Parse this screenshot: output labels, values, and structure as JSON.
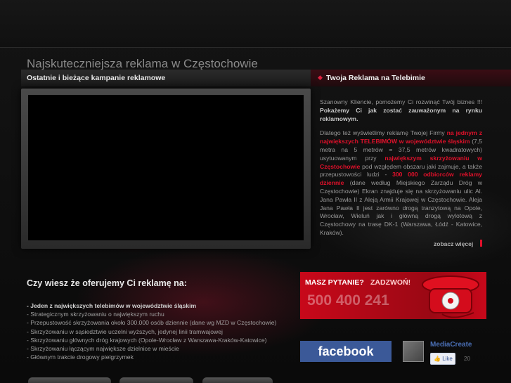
{
  "header": {
    "headline": "Najskuteczniejsza reklama w Częstochowie"
  },
  "left_panel": {
    "title": "Ostatnie i bieżące kampanie reklamowe"
  },
  "right_panel": {
    "title": "Twoja Reklama na Telebimie",
    "paragraph1_a": "Szanowny Kliencie, pomożemy Ci rozwinąć Twój biznes !!! ",
    "paragraph1_b": "Pokażemy Ci jak zostać zauważonym na rynku reklamowym.",
    "p2_1": "Dlatego też wyświetlimy reklamę Twojej Firmy ",
    "p2_2": "na jednym z największych TELEBIMÓW w województwie śląskim",
    "p2_3": " (7,5 metra na 5 metrów = 37,5 metrów kwadratowych) usytuowanym przy ",
    "p2_4": "największym skrzyżowaniu w Częstochowie",
    "p2_5": " pod względem obszaru jaki zajmuje, a także przepustowości ludzi - ",
    "p2_6": "300 000 odbiorców reklamy dziennie",
    "p2_7": " (dane według Miejskiego Zarządu Dróg w Częstochowie) Ekran znajduje się na skrzyżowaniu ulic Al. Jana Pawła II z Aleją Armii Krajowej w Częstochowie. Aleja Jana Pawła II jest zarówno drogą tranzytową na Opole, Wrocław, Wieluń jak i główną drogą wylotową z Częstochowy na trasę DK-1 (Warszawa, Łódź - Katowice, Kraków).",
    "more_link": "zobacz więcej"
  },
  "offer": {
    "question": "Czy wiesz że oferujemy Ci reklamę na:",
    "items": [
      "- Jeden z największych telebimów w województwie śląskim",
      "- Strategicznym skrzyżowaniu o największym ruchu",
      "- Przepustowość skrzyżowania około 300.000 osób dziennie (dane wg MZD w Częstochowie)",
      "- Skrzyżowaniu w sąsiedztwie uczelni wyższych, jedynej linii tramwajowej",
      "- Skrzyżowaniu głównych dróg krajowych (Opole-Wrocław z Warszawa-Kraków-Katowice)",
      "- Skrzyżowaniu łączącym największe dzielnice w mieście",
      "- Głównym trakcie drogowy pielgrzymek"
    ]
  },
  "phone_box": {
    "question": "MASZ PYTANIE?",
    "call": "ZADZWOŃ!",
    "number": "500 400 241"
  },
  "facebook": {
    "logo": "facebook",
    "page_name": "MediaCreate",
    "like_label": "Like",
    "like_count": "20"
  },
  "colors": {
    "accent_red": "#e0102a",
    "facebook_blue": "#3b5998"
  }
}
